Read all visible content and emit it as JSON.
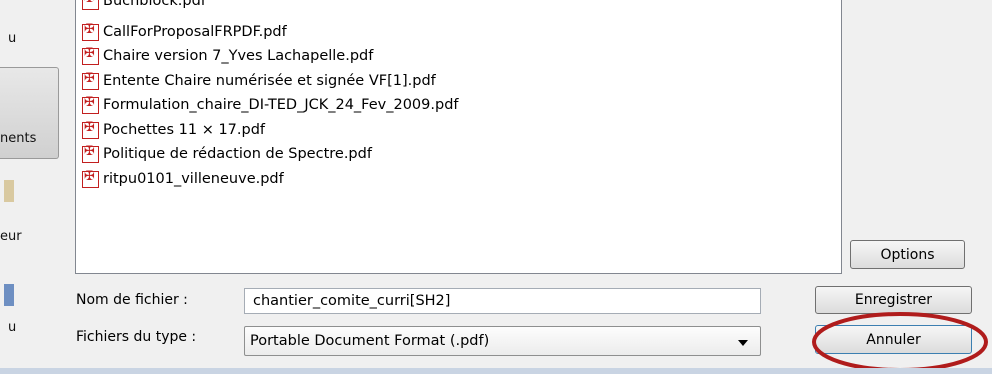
{
  "sidebar": {
    "items": [
      {
        "label": "u"
      },
      {
        "label": "nents"
      },
      {
        "label": "eur"
      },
      {
        "label": "u"
      }
    ]
  },
  "file_list": {
    "files": [
      "Buchblock.pdf",
      "CallForProposalFRPDF.pdf",
      "Chaire version 7_Yves Lachapelle.pdf",
      "Entente Chaire numérisée et signée VF[1].pdf",
      "Formulation_chaire_DI-TED_JCK_24_Fev_2009.pdf",
      "Pochettes 11 × 17.pdf",
      "Politique de rédaction de Spectre.pdf",
      "ritpu0101_villeneuve.pdf"
    ]
  },
  "options_button": {
    "label": "Options"
  },
  "filename": {
    "label": "Nom de fichier :",
    "value": "chantier_comite_curri[SH2]"
  },
  "filetype": {
    "label": "Fichiers du type :",
    "value": "Portable Document Format (.pdf)"
  },
  "save_button": {
    "label": "Enregistrer"
  },
  "cancel_button": {
    "label": "Annuler"
  },
  "colors": {
    "annotation_circle": "#b01c1c",
    "pdf_icon": "#c21f1f"
  }
}
